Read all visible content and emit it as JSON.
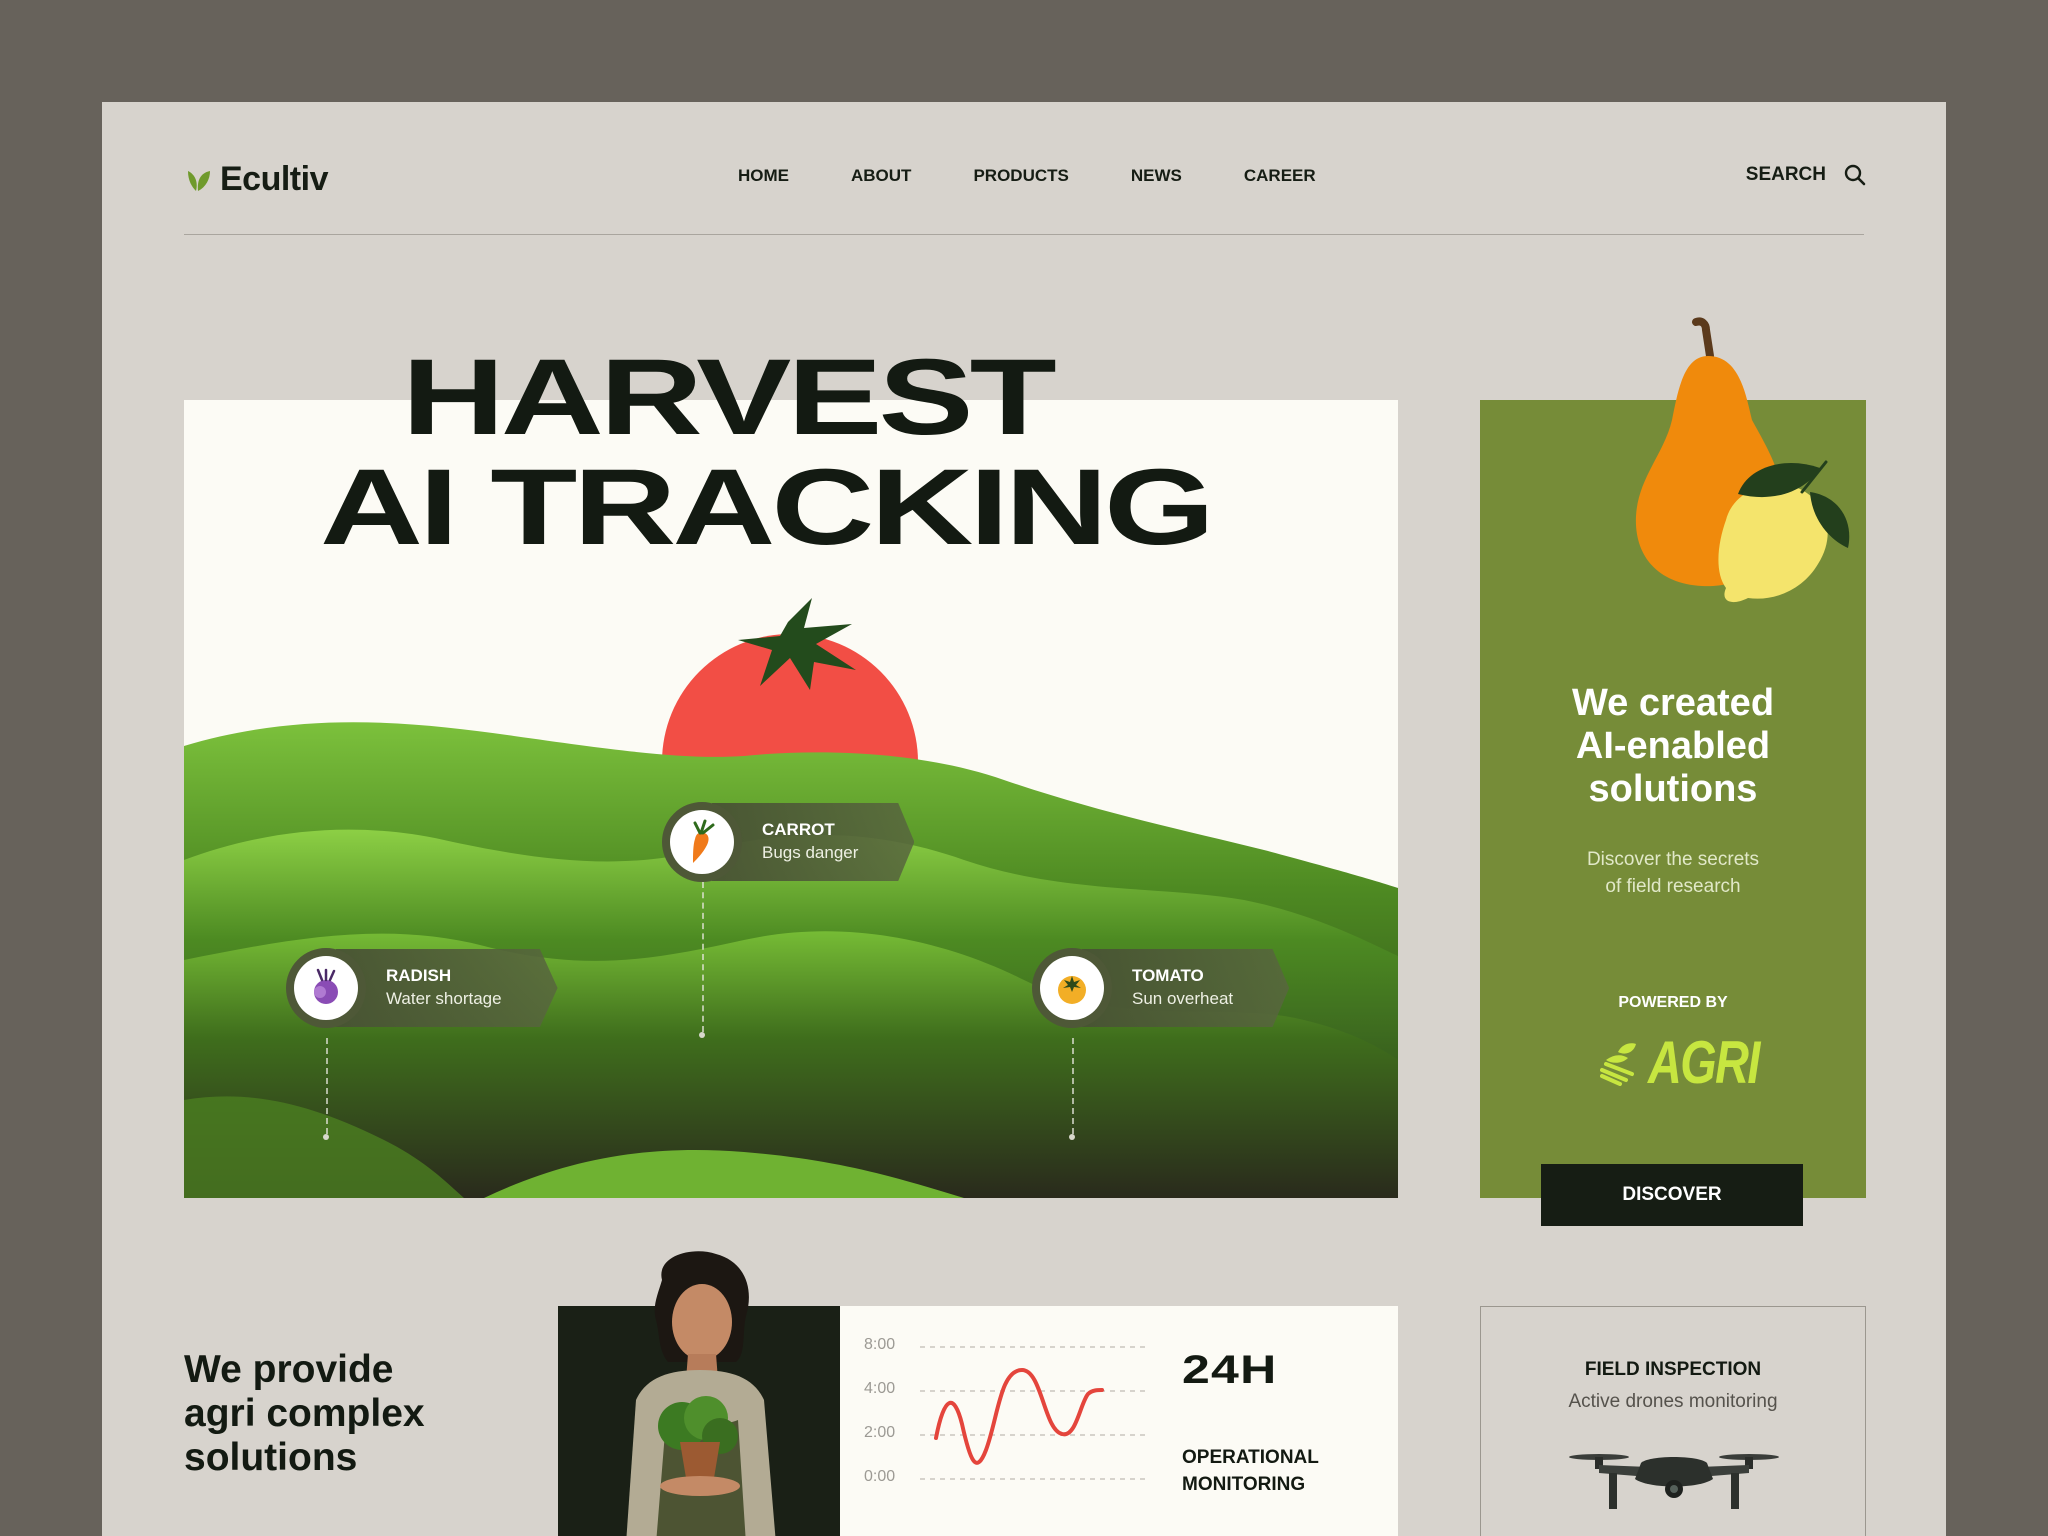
{
  "brand": {
    "name": "Ecultiv"
  },
  "nav": {
    "items": [
      {
        "label": "HOME"
      },
      {
        "label": "ABOUT"
      },
      {
        "label": "PRODUCTS"
      },
      {
        "label": "NEWS"
      },
      {
        "label": "CAREER"
      }
    ],
    "search_label": "SEARCH"
  },
  "hero": {
    "headline_line1": "HARVEST",
    "headline_line2": "AI TRACKING",
    "tags": [
      {
        "crop": "CARROT",
        "status": "Bugs danger",
        "icon": "carrot-icon"
      },
      {
        "crop": "RADISH",
        "status": "Water shortage",
        "icon": "radish-icon"
      },
      {
        "crop": "TOMATO",
        "status": "Sun overheat",
        "icon": "tomato-icon"
      }
    ]
  },
  "promo": {
    "title_line1": "We created",
    "title_line2": "AI-enabled",
    "title_line3": "solutions",
    "sub_line1": "Discover the secrets",
    "sub_line2": "of field research",
    "powered_by": "POWERED BY",
    "partner": "AGRI",
    "cta": "DISCOVER"
  },
  "services": {
    "line1": "We provide",
    "line2": "agri complex",
    "line3": "solutions"
  },
  "monitoring": {
    "y_labels": [
      "8:00",
      "4:00",
      "2:00",
      "0:00"
    ],
    "headline": "24H",
    "label_line1": "OPERATIONAL",
    "label_line2": "MONITORING"
  },
  "inspection": {
    "title": "FIELD INSPECTION",
    "subtitle": "Active drones monitoring"
  },
  "colors": {
    "background_frame": "#67625b",
    "page": "#d7d3cd",
    "accent_green": "#768c38",
    "dark": "#161d14",
    "tomato_red": "#f24e45",
    "agri_lime": "#c7e640"
  }
}
